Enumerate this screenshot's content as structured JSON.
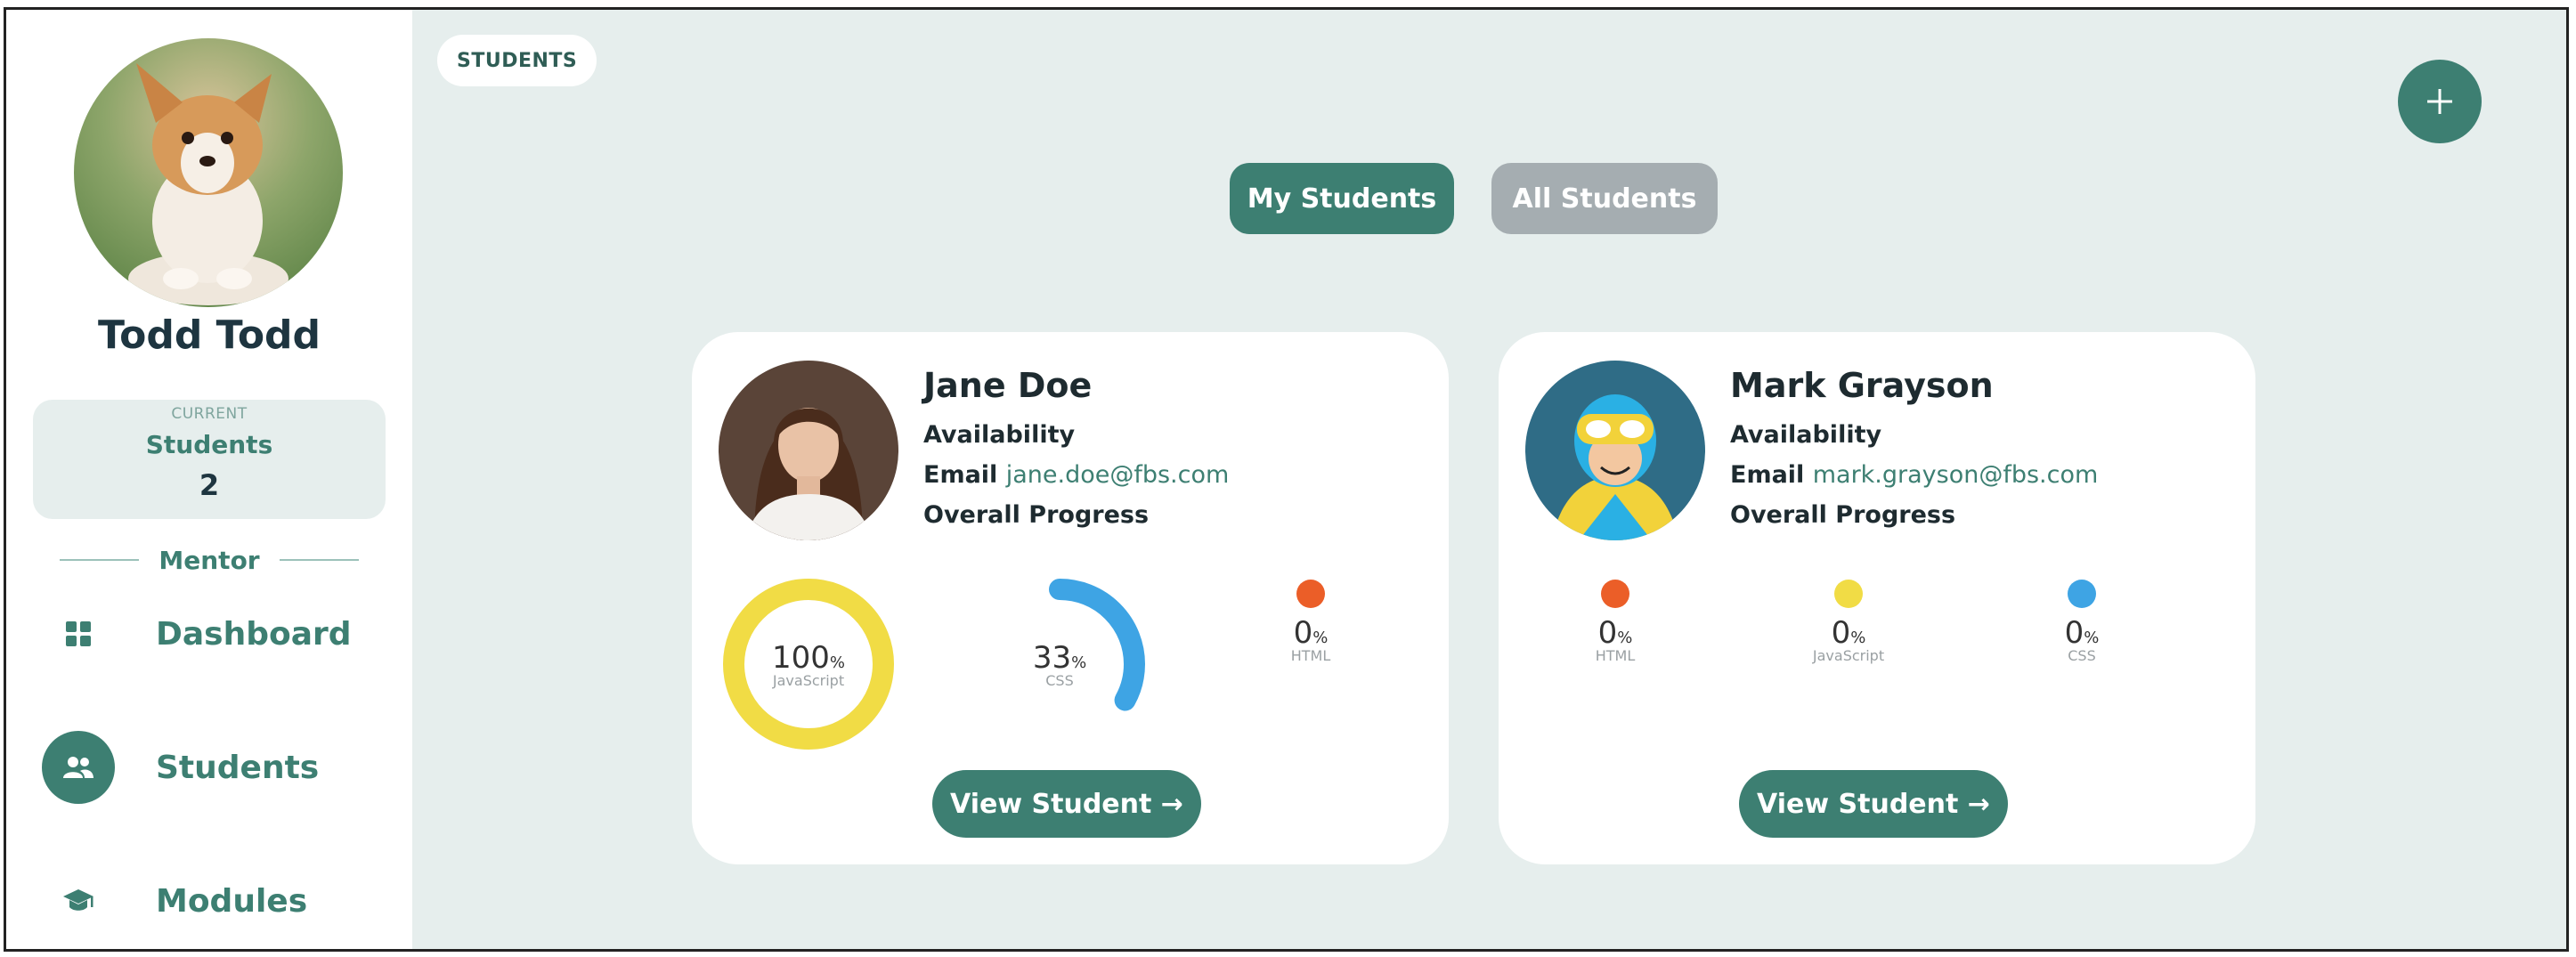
{
  "sidebar": {
    "user_name": "Todd Todd",
    "current_caption": "CURRENT",
    "current_label": "Students",
    "current_count": "2",
    "role": "Mentor",
    "nav": [
      {
        "label": "Dashboard",
        "icon": "grid-icon",
        "active": false
      },
      {
        "label": "Students",
        "icon": "users-icon",
        "active": true
      },
      {
        "label": "Modules",
        "icon": "graduation-cap-icon",
        "active": false
      }
    ]
  },
  "breadcrumb": "STUDENTS",
  "add_icon": "plus-icon",
  "tabs": {
    "my_students": "My Students",
    "all_students": "All Students"
  },
  "students": [
    {
      "name": "Jane Doe",
      "availability_label": "Availability",
      "email_label": "Email",
      "email": "jane.doe@fbs.com",
      "progress_label": "Overall Progress",
      "skills": [
        {
          "name": "JavaScript",
          "value": "100",
          "unit": "%",
          "progress": 1.0,
          "color": "#f1dc45",
          "display": "ring"
        },
        {
          "name": "CSS",
          "value": "33",
          "unit": "%",
          "progress": 0.33,
          "color": "#3ea4e4",
          "display": "ring"
        },
        {
          "name": "HTML",
          "value": "0",
          "unit": "%",
          "progress": 0,
          "color": "#eb5e28",
          "display": "dot"
        }
      ],
      "button_label": "View Student →"
    },
    {
      "name": "Mark Grayson",
      "availability_label": "Availability",
      "email_label": "Email",
      "email": "mark.grayson@fbs.com",
      "progress_label": "Overall Progress",
      "skills": [
        {
          "name": "HTML",
          "value": "0",
          "unit": "%",
          "progress": 0,
          "color": "#eb5e28",
          "display": "dot"
        },
        {
          "name": "JavaScript",
          "value": "0",
          "unit": "%",
          "progress": 0,
          "color": "#f1dc45",
          "display": "dot"
        },
        {
          "name": "CSS",
          "value": "0",
          "unit": "%",
          "progress": 0,
          "color": "#3ea4e4",
          "display": "dot"
        }
      ],
      "button_label": "View Student →"
    }
  ],
  "colors": {
    "accent": "#3d7f72",
    "background": "#e6eeed",
    "inactive_tab": "#a5adb1"
  }
}
